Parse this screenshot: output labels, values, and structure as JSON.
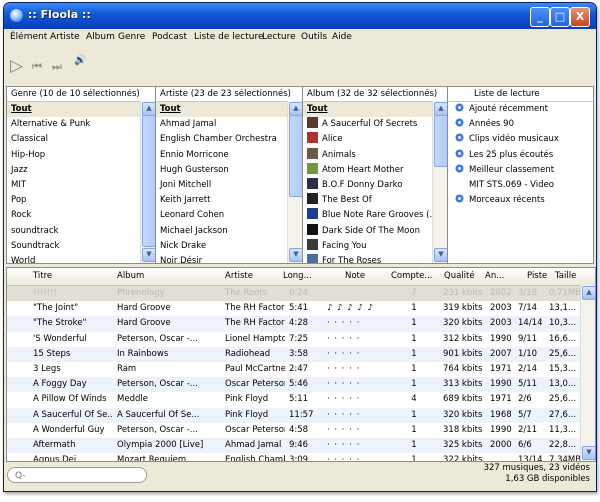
{
  "window": {
    "title": ":: Floola ::",
    "controls": {
      "minimize": "_",
      "maximize": "□",
      "close": "X"
    }
  },
  "menu": [
    "Élément",
    "Artiste",
    "Album",
    "Genre",
    "Podcast",
    "Liste de lecture",
    "Lecture",
    "Outils",
    "Aide"
  ],
  "toolbar": {
    "play": "▷",
    "prev": "⏮",
    "next": "⏭",
    "volume": "🔊"
  },
  "genre": {
    "header": "Genre (10 de 10 sélectionnés)",
    "items": [
      "Tout",
      "Alternative & Punk",
      "Classical",
      "Hip-Hop",
      "Jazz",
      "MIT",
      "Pop",
      "Rock",
      "soundtrack",
      "Soundtrack",
      "World"
    ]
  },
  "artist": {
    "header": "Artiste (23 de 23 sélectionnés)",
    "items": [
      "Tout",
      "Ahmad Jamal",
      "English Chamber Orchestra",
      "Ennio Morricone",
      "Hugh Gusterson",
      "Joni Mitchell",
      "Keith Jarrett",
      "Leonard Cohen",
      "Michael Jackson",
      "Nick Drake",
      "Noir Désir"
    ]
  },
  "album": {
    "header": "Album (32 de 32 sélectionnés)",
    "items": [
      "Tout",
      "A Saucerful Of Secrets",
      "Alice",
      "Animals",
      "Atom Heart Mother",
      "B.O.F Donny Darko",
      "The Best Of",
      "Blue Note Rare Grooves (...",
      "Dark Side Of The Moon",
      "Facing You",
      "For The Roses"
    ],
    "art_colors": [
      "",
      "#5a3b2e",
      "#b0322a",
      "#6b5a45",
      "#6e9a3c",
      "#2a2d4a",
      "#222222",
      "#1d3f8a",
      "#111111",
      "#3a3a3a",
      "#4d6d9a"
    ]
  },
  "playlist": {
    "header": "Liste de lecture",
    "items": [
      {
        "label": "Ajouté récemment",
        "icon": true
      },
      {
        "label": "Années 90",
        "icon": true
      },
      {
        "label": "Clips vidéo musicaux",
        "icon": true
      },
      {
        "label": "Les 25 plus écoutés",
        "icon": true
      },
      {
        "label": "Meilleur classement",
        "icon": true
      },
      {
        "label": "MIT STS.069 - Video",
        "icon": false
      },
      {
        "label": "Morceaux récents",
        "icon": true
      }
    ]
  },
  "songs": {
    "columns": [
      "Titre",
      "Album",
      "Artiste",
      "Long...",
      "Note",
      "Compte...",
      "Qualité",
      "An...",
      "Piste",
      "Taille"
    ],
    "rows": [
      {
        "title": "!!!!!!!",
        "album": "Phrenology",
        "artist": "The Roots",
        "length": "0:24",
        "note": "",
        "count": "7",
        "quality": "231 kbits",
        "year": "2002",
        "track": "3/18",
        "size": "0,71MB"
      },
      {
        "title": "\"The Joint\"",
        "album": "Hard Groove",
        "artist": "The RH Factor",
        "length": "5:41",
        "note": "♪ ♪ ♪ ♪ ♪",
        "count": "1",
        "quality": "319 kbits",
        "year": "2003",
        "track": "7/14",
        "size": "13,1..."
      },
      {
        "title": "\"The Stroke\"",
        "album": "Hard Groove",
        "artist": "The RH Factor",
        "length": "4:28",
        "note": "· · · · ·",
        "count": "1",
        "quality": "320 kbits",
        "year": "2003",
        "track": "14/14",
        "size": "10,3..."
      },
      {
        "title": "'S Wonderful",
        "album": "Peterson, Oscar -...",
        "artist": "Lionel Hampton & ...",
        "length": "7:25",
        "note": "· · · · ·",
        "count": "1",
        "quality": "312 kbits",
        "year": "1990",
        "track": "9/11",
        "size": "16,6..."
      },
      {
        "title": "15 Steps",
        "album": "In Rainbows",
        "artist": "Radiohead",
        "length": "3:58",
        "note": "· · · · ·",
        "count": "1",
        "quality": "901 kbits",
        "year": "2007",
        "track": "1/10",
        "size": "25,6..."
      },
      {
        "title": "3 Legs",
        "album": "Ram",
        "artist": "Paul McCartney",
        "length": "2:47",
        "note": "· · · · ·",
        "count": "1",
        "quality": "764 kbits",
        "year": "1971",
        "track": "2/14",
        "size": "15,3..."
      },
      {
        "title": "A Foggy Day",
        "album": "Peterson, Oscar -...",
        "artist": "Oscar Peterson/R...",
        "length": "5:46",
        "note": "· · · · ·",
        "count": "1",
        "quality": "313 kbits",
        "year": "1990",
        "track": "5/11",
        "size": "13,0..."
      },
      {
        "title": "A Pillow Of Winds",
        "album": "Meddle",
        "artist": "Pink Floyd",
        "length": "5:11",
        "note": "· · · · ·",
        "count": "4",
        "quality": "689 kbits",
        "year": "1971",
        "track": "2/6",
        "size": "25,6..."
      },
      {
        "title": "A Saucerful Of Se...",
        "album": "A Saucerful Of Se...",
        "artist": "Pink Floyd",
        "length": "11:57",
        "note": "· · · · ·",
        "count": "1",
        "quality": "320 kbits",
        "year": "1968",
        "track": "5/7",
        "size": "27,6..."
      },
      {
        "title": "A Wonderful Guy",
        "album": "Peterson, Oscar -...",
        "artist": "Oscar Peterson &...",
        "length": "4:58",
        "note": "· · · · ·",
        "count": "1",
        "quality": "318 kbits",
        "year": "1990",
        "track": "2/11",
        "size": "11,3..."
      },
      {
        "title": "Aftermath",
        "album": "Olympia 2000 [Live]",
        "artist": "Ahmad Jamal",
        "length": "9:46",
        "note": "· · · · ·",
        "count": "1",
        "quality": "325 kbits",
        "year": "2000",
        "track": "6/6",
        "size": "22,8..."
      },
      {
        "title": "Agnus Dei",
        "album": "Mozart Requiem",
        "artist": "English Chamber ...",
        "length": "3:09",
        "note": "· · · · ·",
        "count": "1",
        "quality": "322 kbits",
        "year": "",
        "track": "13/14",
        "size": "7,34MB"
      }
    ]
  },
  "search": {
    "placeholder": "Q-"
  },
  "status": {
    "line1": "327 musiques, 23 vidéos",
    "line2": "1,63 GB disponibles"
  },
  "colors": {
    "titlebar": "#0c49c9",
    "selection": "#ece9d8",
    "alt_row": "#eef3fb",
    "song_icon": "#8aa82a"
  }
}
